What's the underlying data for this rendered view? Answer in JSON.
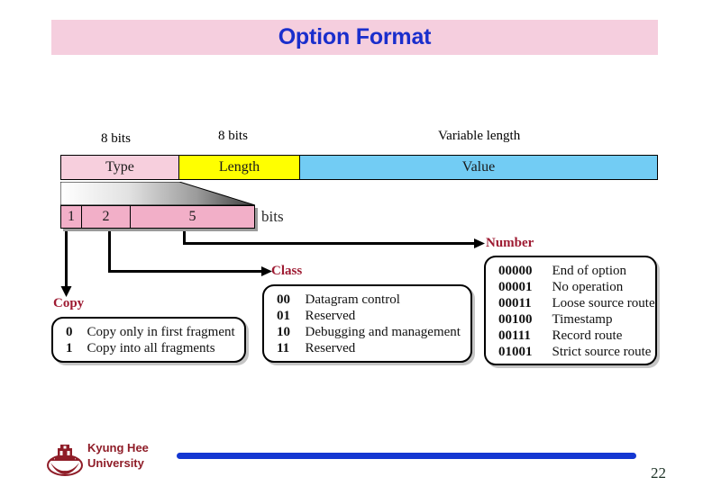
{
  "slide": {
    "title": "Option Format",
    "page_number": "22",
    "colors": {
      "title_banner_bg": "#f5cede",
      "title_text": "#1a2ecc",
      "type_field": "#f7cfdd",
      "length_field": "#ffff00",
      "value_field": "#72ccf4",
      "bit_cells": "#f2afc8",
      "branch_label": "#9e1b32",
      "footer_rule": "#1437d2",
      "footer_text": "#8f1d28"
    }
  },
  "diagram": {
    "size_labels": {
      "type": "8 bits",
      "length": "8 bits",
      "value": "Variable length"
    },
    "fields": {
      "type": "Type",
      "length": "Length",
      "value": "Value"
    },
    "bit_split": {
      "cells": [
        "1",
        "2",
        "5"
      ],
      "unit": "bits"
    },
    "branches": {
      "copy": "Copy",
      "class": "Class",
      "number": "Number"
    },
    "copy_box": [
      {
        "code": "0",
        "desc": "Copy only in first fragment"
      },
      {
        "code": "1",
        "desc": "Copy into all fragments"
      }
    ],
    "class_box": [
      {
        "code": "00",
        "desc": "Datagram control"
      },
      {
        "code": "01",
        "desc": "Reserved"
      },
      {
        "code": "10",
        "desc": "Debugging and management"
      },
      {
        "code": "11",
        "desc": "Reserved"
      }
    ],
    "number_box": [
      {
        "code": "00000",
        "desc": "End of option"
      },
      {
        "code": "00001",
        "desc": "No operation"
      },
      {
        "code": "00011",
        "desc": "Loose source route"
      },
      {
        "code": "00100",
        "desc": "Timestamp"
      },
      {
        "code": "00111",
        "desc": "Record route"
      },
      {
        "code": "01001",
        "desc": "Strict source route"
      }
    ]
  },
  "footer": {
    "university_line1": "Kyung Hee",
    "university_line2": "University",
    "logo_icon": "university-crest-icon"
  }
}
